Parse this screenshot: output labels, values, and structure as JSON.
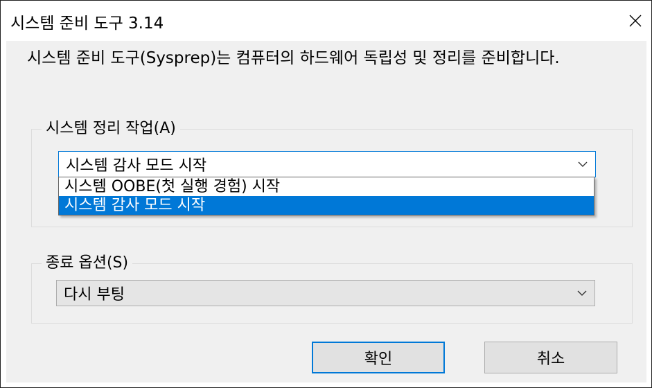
{
  "window": {
    "title": "시스템 준비 도구 3.14"
  },
  "description": "시스템 준비 도구(Sysprep)는 컴퓨터의 하드웨어 독립성 및 정리를 준비합니다.",
  "cleanup_group": {
    "label": "시스템 정리 작업(A)",
    "selected_value": "시스템 감사 모드 시작",
    "options": [
      "시스템 OOBE(첫 실행 경험) 시작",
      "시스템 감사 모드 시작"
    ]
  },
  "shutdown_group": {
    "label": "종료 옵션(S)",
    "selected_value": "다시 부팅"
  },
  "buttons": {
    "ok": "확인",
    "cancel": "취소"
  },
  "icons": {
    "close": "close-icon",
    "dropdown": "chevron-down-icon"
  },
  "colors": {
    "accent": "#0078d7",
    "dialog_background": "#f0f0f0",
    "selected_item_text": "#ffffff"
  }
}
